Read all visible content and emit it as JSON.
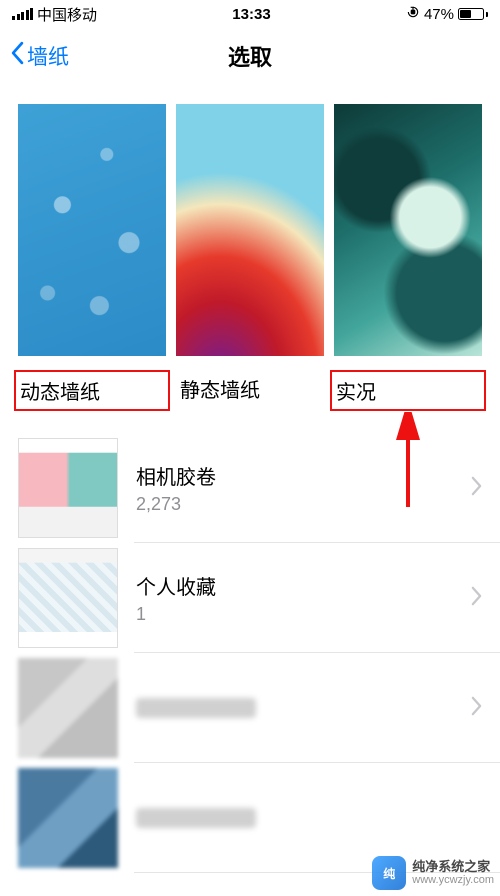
{
  "status": {
    "carrier": "中国移动",
    "time": "13:33",
    "battery_pct": "47%"
  },
  "nav": {
    "back_label": "墙纸",
    "title": "选取"
  },
  "wallpaper_categories": [
    {
      "label": "动态墙纸",
      "highlighted": true
    },
    {
      "label": "静态墙纸",
      "highlighted": false
    },
    {
      "label": "实况",
      "highlighted": true
    }
  ],
  "albums": [
    {
      "name": "相机胶卷",
      "count": "2,273"
    },
    {
      "name": "个人收藏",
      "count": "1"
    },
    {
      "name": "",
      "count": ""
    },
    {
      "name": "",
      "count": ""
    }
  ],
  "watermark": {
    "name": "纯净系统之家",
    "url": "www.ycwzjy.com"
  }
}
